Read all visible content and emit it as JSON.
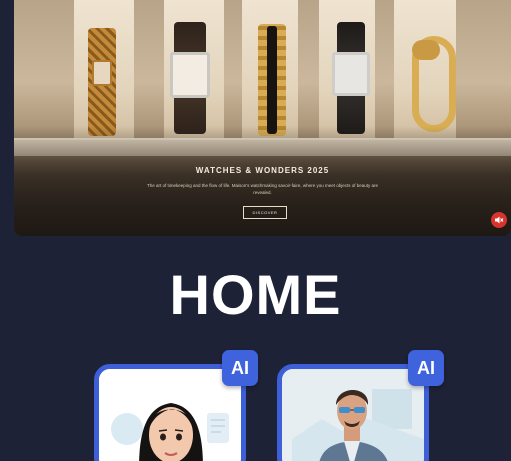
{
  "banner": {
    "title": "WATCHES & WONDERS 2025",
    "description": "The art of timekeeping and the flow of life. Maison's watchmaking savoir-faire, where you meet objects of beauty are revealed.",
    "discover_label": "DISCOVER",
    "mute_icon": "speaker-muted-icon"
  },
  "home": {
    "title": "HOME"
  },
  "cards": [
    {
      "badge": "AI",
      "avatar": "woman-portrait"
    },
    {
      "badge": "AI",
      "avatar": "man-portrait"
    }
  ],
  "colors": {
    "background": "#1e2236",
    "accent": "#3d5fd8",
    "mute": "#d8342e"
  }
}
